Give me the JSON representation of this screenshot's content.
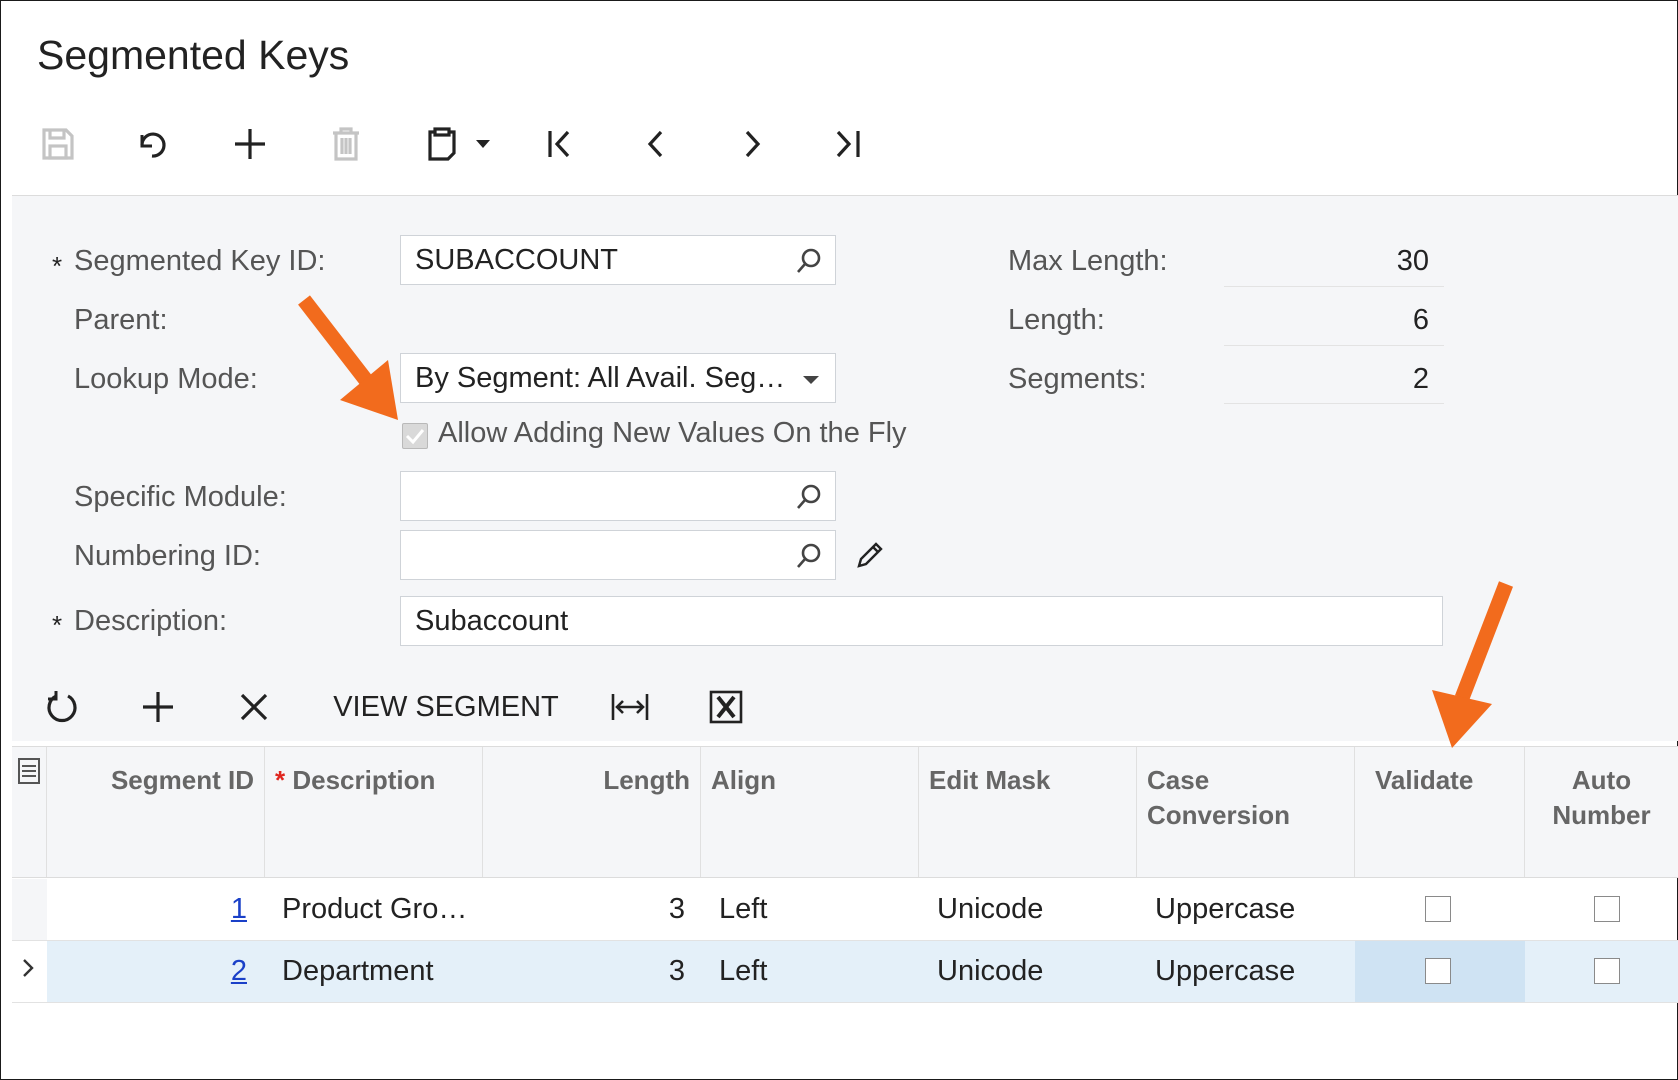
{
  "page": {
    "title": "Segmented Keys"
  },
  "toolbar": {
    "icons": [
      "save-icon",
      "undo-icon",
      "add-icon",
      "delete-icon",
      "clipboard-icon",
      "first-icon",
      "prev-icon",
      "next-icon",
      "last-icon"
    ]
  },
  "form": {
    "segmented_key_id": {
      "label": "Segmented Key ID:",
      "value": "SUBACCOUNT",
      "required": "*"
    },
    "parent": {
      "label": "Parent:"
    },
    "lookup_mode": {
      "label": "Lookup Mode:",
      "value": "By Segment: All Avail. Seg…"
    },
    "allow_adding": {
      "label": "Allow Adding New Values On the Fly",
      "checked": true,
      "disabled": true
    },
    "specific_module": {
      "label": "Specific Module:",
      "value": ""
    },
    "numbering_id": {
      "label": "Numbering ID:",
      "value": ""
    },
    "description": {
      "label": "Description:",
      "value": "Subaccount",
      "required": "*"
    },
    "max_length": {
      "label": "Max Length:",
      "value": "30"
    },
    "length": {
      "label": "Length:",
      "value": "6"
    },
    "segments": {
      "label": "Segments:",
      "value": "2"
    }
  },
  "grid_toolbar": {
    "view_segment_label": "VIEW SEGMENT"
  },
  "grid": {
    "columns": {
      "segment_id": "Segment ID",
      "description_req": "*",
      "description": "Description",
      "length": "Length",
      "align": "Align",
      "edit_mask": "Edit Mask",
      "case_conversion_1": "Case",
      "case_conversion_2": "Conversion",
      "validate": "Validate",
      "auto_number_1": "Auto",
      "auto_number_2": "Number"
    },
    "rows": [
      {
        "segment_id": "1",
        "description": "Product Gro…",
        "length": "3",
        "align": "Left",
        "edit_mask": "Unicode",
        "case_conversion": "Uppercase",
        "validate": false,
        "auto_number": false
      },
      {
        "segment_id": "2",
        "description": "Department",
        "length": "3",
        "align": "Left",
        "edit_mask": "Unicode",
        "case_conversion": "Uppercase",
        "validate": false,
        "auto_number": false
      }
    ]
  },
  "annotations": {
    "arrow_color": "#f26b1d"
  },
  "colors": {
    "link": "#1a40c8",
    "selected_row": "#e4f0f9",
    "selected_cell": "#cfe3f3"
  }
}
